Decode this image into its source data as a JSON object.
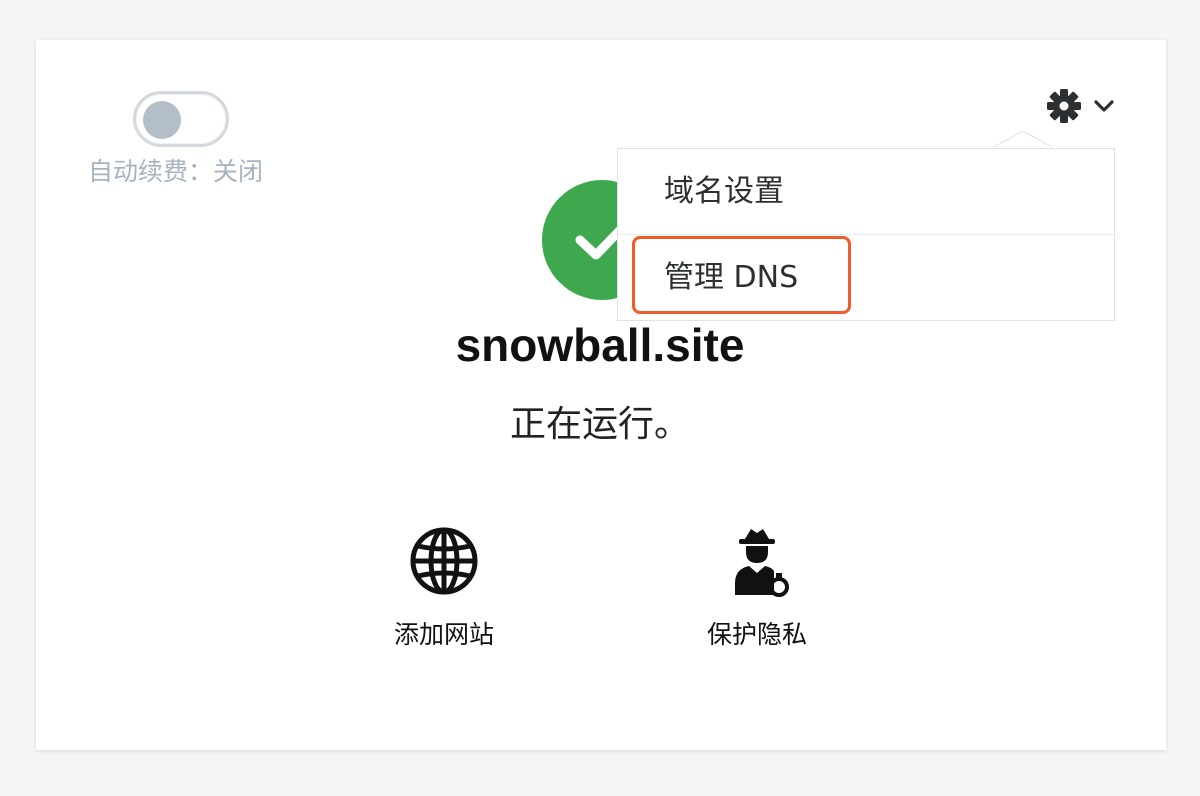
{
  "auto_renew": {
    "label": "自动续费：关闭",
    "enabled": false
  },
  "settings_menu": {
    "icon": "gear-icon",
    "chevron": "chevron-down-icon",
    "items": [
      {
        "label": "域名设置"
      },
      {
        "label": "管理 DNS",
        "highlighted": true
      }
    ]
  },
  "domain": {
    "name": "snowball.site",
    "status": "正在运行。",
    "status_icon": "check-circle-icon"
  },
  "actions": [
    {
      "label": "添加网站",
      "icon": "globe-icon"
    },
    {
      "label": "保护隐私",
      "icon": "privacy-agent-icon"
    }
  ],
  "colors": {
    "success": "#3fa74e",
    "highlight": "#f15a29",
    "muted": "#a7b3be"
  }
}
